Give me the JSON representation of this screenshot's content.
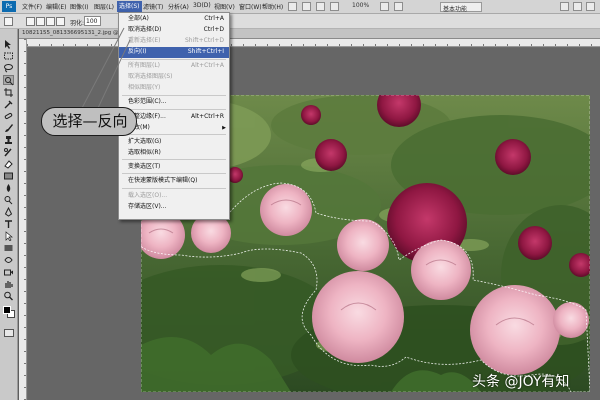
{
  "menubar": {
    "logo": "Ps",
    "items": [
      "文件(F)",
      "编辑(E)",
      "图像(I)",
      "图层(L)",
      "选择(S)",
      "滤镜(T)",
      "分析(A)",
      "3D(D)",
      "视图(V)",
      "窗口(W)",
      "帮助(H)"
    ],
    "active_index": 4,
    "zoom": "100%",
    "workspace_label": "基本功能"
  },
  "options_bar": {
    "feather_label": "羽化:",
    "feather_value": "100"
  },
  "document": {
    "tab_label": "10821155_081336695131_2.jpg @ 66.7%(RGB/8#)"
  },
  "select_menu": {
    "items": [
      {
        "label": "全部(A)",
        "shortcut": "Ctrl+A",
        "enabled": true
      },
      {
        "label": "取消选择(D)",
        "shortcut": "Ctrl+D",
        "enabled": true
      },
      {
        "label": "重新选择(E)",
        "shortcut": "Shift+Ctrl+D",
        "enabled": false
      },
      {
        "label": "反向(I)",
        "shortcut": "Shift+Ctrl+I",
        "enabled": true,
        "highlighted": true
      },
      {
        "label": "所有图层(L)",
        "shortcut": "Alt+Ctrl+A",
        "enabled": false
      },
      {
        "label": "取消选择图层(S)",
        "shortcut": "",
        "enabled": false
      },
      {
        "label": "相似图层(Y)",
        "shortcut": "",
        "enabled": false
      },
      {
        "label": "色彩范围(C)...",
        "shortcut": "",
        "enabled": true
      },
      {
        "label": "调整边缘(F)...",
        "shortcut": "Alt+Ctrl+R",
        "enabled": true
      },
      {
        "label": "修改(M)",
        "shortcut": "",
        "enabled": true,
        "submenu": true
      },
      {
        "label": "扩大选取(G)",
        "shortcut": "",
        "enabled": true
      },
      {
        "label": "选取相似(R)",
        "shortcut": "",
        "enabled": true
      },
      {
        "label": "变换选区(T)",
        "shortcut": "",
        "enabled": true
      },
      {
        "label": "在快速蒙版模式下编辑(Q)",
        "shortcut": "",
        "enabled": true
      },
      {
        "label": "载入选区(O)...",
        "shortcut": "",
        "enabled": false
      },
      {
        "label": "存储选区(V)...",
        "shortcut": "",
        "enabled": true
      }
    ]
  },
  "callout": {
    "text": "选择—反向"
  },
  "watermark": {
    "text": "头条 @JOY有知"
  },
  "colors": {
    "highlight": "#3f62ad",
    "menu_bg": "#f0f0f0",
    "foreground_color": "#000000",
    "background_color": "#ffffff"
  },
  "tools": [
    "move-icon",
    "marquee-icon",
    "lasso-icon",
    "quick-selection-icon",
    "crop-icon",
    "eyedropper-icon",
    "healing-icon",
    "brush-icon",
    "clone-stamp-icon",
    "history-brush-icon",
    "eraser-icon",
    "gradient-icon",
    "blur-icon",
    "dodge-icon",
    "pen-icon",
    "type-icon",
    "path-selection-icon",
    "shape-icon",
    "3d-rotate-icon",
    "3d-camera-icon",
    "hand-icon",
    "zoom-icon"
  ]
}
